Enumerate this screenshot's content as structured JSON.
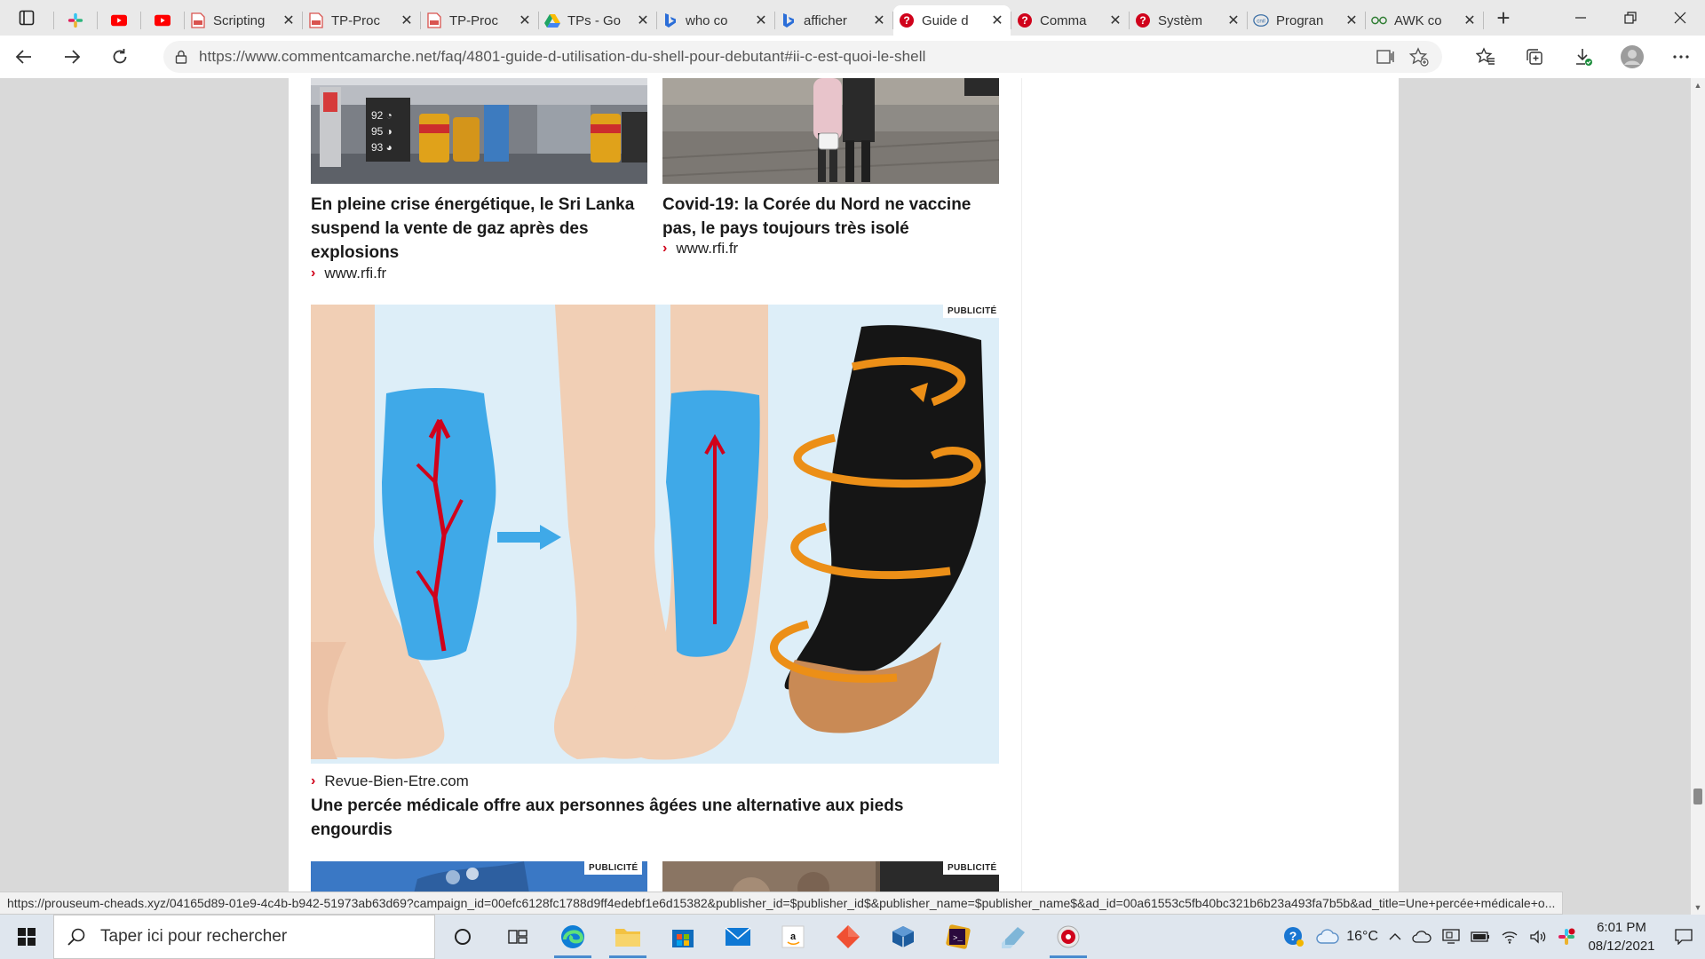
{
  "browser": {
    "tabs": [
      {
        "kind": "pinned",
        "icon": "slack-icon",
        "color": "#e01e5a"
      },
      {
        "kind": "pinned",
        "icon": "youtube-icon",
        "color": "#ff0000"
      },
      {
        "kind": "pinned",
        "icon": "youtube-icon",
        "color": "#ff0000"
      },
      {
        "kind": "regular",
        "icon": "pdf-icon",
        "title": "Scripting",
        "color": "#d9534f"
      },
      {
        "kind": "regular",
        "icon": "pdf-icon",
        "title": "TP-Proc",
        "color": "#d9534f"
      },
      {
        "kind": "regular",
        "icon": "pdf-icon",
        "title": "TP-Proc",
        "color": "#d9534f"
      },
      {
        "kind": "regular",
        "icon": "drive-icon",
        "title": "TPs - Go",
        "color": "#1fa463"
      },
      {
        "kind": "regular",
        "icon": "bing-icon",
        "title": "who co",
        "color": "#2b6ed8"
      },
      {
        "kind": "regular",
        "icon": "bing-icon",
        "title": "afficher",
        "color": "#2b6ed8"
      },
      {
        "kind": "regular",
        "icon": "question-icon",
        "title": "Guide d",
        "color": "#d0021b",
        "active": true
      },
      {
        "kind": "regular",
        "icon": "question-icon",
        "title": "Comma",
        "color": "#d0021b"
      },
      {
        "kind": "regular",
        "icon": "question-icon",
        "title": "Systèm",
        "color": "#d0021b"
      },
      {
        "kind": "regular",
        "icon": "cnil-icon",
        "title": "Progran",
        "color": "#3a6ea5"
      },
      {
        "kind": "regular",
        "icon": "glasses-icon",
        "title": "AWK co",
        "color": "#2e7d32"
      }
    ],
    "url": "https://www.commentcamarche.net/faq/4801-guide-d-utilisation-du-shell-pour-debutant#ii-c-est-quoi-le-shell",
    "new_tab_symbol": "+",
    "close_symbol": "✕"
  },
  "page": {
    "cards": {
      "left_title": "En pleine crise énergétique, le Sri Lanka suspend la vente de gaz après des explosions",
      "left_source": "www.rfi.fr",
      "right_title": "Covid-19: la Corée du Nord ne vaccine pas, le pays toujours très isolé",
      "right_source": "www.rfi.fr"
    },
    "ad": {
      "badge": "PUBLICITÉ",
      "source": "Revue-Bien-Etre.com",
      "title": "Une percée médicale offre aux personnes âgées une alternative aux pieds engourdis"
    },
    "bottom_badges": {
      "left": "PUBLICITÉ",
      "right": "PUBLICITÉ"
    }
  },
  "statusbar": {
    "link": "https://prouseum-cheads.xyz/04165d89-01e9-4c4b-b942-51973ab63d69?campaign_id=00efc6128fc1788d9ff4edebf1e6d15382&publisher_id=$publisher_id$&publisher_name=$publisher_name$&ad_id=00a61553c5fb40bc321b6b23a493fa7b5b&ad_title=Une+percée+médicale+o..."
  },
  "taskbar": {
    "search_placeholder": "Taper ici pour rechercher",
    "apps": [
      "cortana-icon",
      "task-view-icon",
      "edge-icon",
      "file-explorer-icon",
      "store-icon",
      "mail-icon",
      "amazon-icon",
      "git-icon",
      "virtualbox-icon",
      "ubuntu-terminal-icon",
      "notes-icon",
      "media-icon"
    ],
    "weather": "16°C",
    "time": "6:01 PM",
    "date": "08/12/2021"
  }
}
